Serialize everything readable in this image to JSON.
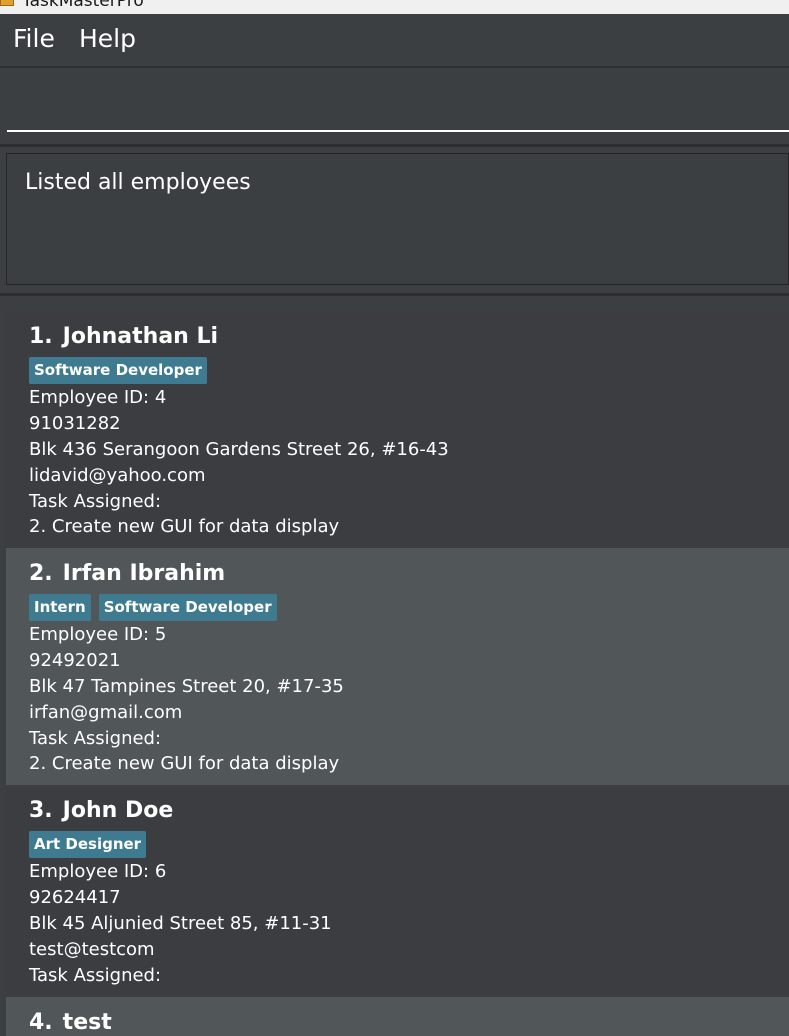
{
  "window": {
    "title": "TaskMasterPro"
  },
  "menu": {
    "file_label": "File",
    "help_label": "Help"
  },
  "command_box": {
    "value": ""
  },
  "result_display": {
    "text": "Listed all employees"
  },
  "employees": [
    {
      "index": "1.",
      "name": "Johnathan Li",
      "tags": [
        "Software Developer"
      ],
      "employee_id": "Employee ID: 4",
      "phone": "91031282",
      "address": "Blk 436 Serangoon Gardens Street 26, #16-43",
      "email": "lidavid@yahoo.com",
      "task_label": "Task Assigned:",
      "task": "2. Create new GUI for data display"
    },
    {
      "index": "2.",
      "name": "Irfan Ibrahim",
      "tags": [
        "Intern",
        "Software Developer"
      ],
      "employee_id": "Employee ID: 5",
      "phone": "92492021",
      "address": "Blk 47 Tampines Street 20, #17-35",
      "email": "irfan@gmail.com",
      "task_label": "Task Assigned:",
      "task": "2. Create new GUI for data display"
    },
    {
      "index": "3.",
      "name": "John Doe",
      "tags": [
        "Art Designer"
      ],
      "employee_id": "Employee ID: 6",
      "phone": "92624417",
      "address": "Blk 45 Aljunied Street 85, #11-31",
      "email": "test@testcom",
      "task_label": "Task Assigned:",
      "task": ""
    },
    {
      "index": "4.",
      "name": "test",
      "tags": [],
      "employee_id": "",
      "phone": "",
      "address": "",
      "email": "",
      "task_label": "",
      "task": ""
    }
  ],
  "colors": {
    "background": "#3c3f41",
    "card_odd": "#3c3d40",
    "card_even": "#515658",
    "tag": "#3e7b91",
    "text": "#ffffff"
  }
}
